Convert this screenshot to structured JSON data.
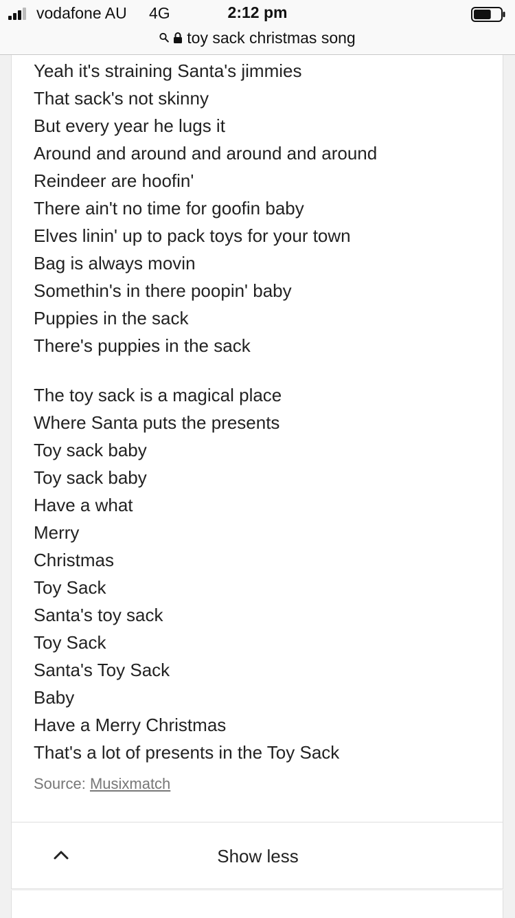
{
  "status_bar": {
    "carrier": "vodafone AU",
    "network": "4G",
    "time": "2:12 pm",
    "signal_bars": 3,
    "battery_level": 0.65
  },
  "url_bar": {
    "query": "toy sack christmas song",
    "search_icon": "search-icon",
    "lock_icon": "lock-icon"
  },
  "lyrics": {
    "stanza1": [
      "Yeah it's straining Santa's jimmies",
      "That sack's not skinny",
      "But every year he lugs it",
      "Around and around and around and around",
      "Reindeer are hoofin'",
      "There ain't no time for goofin baby",
      "Elves linin' up to pack toys for your town",
      "Bag is always movin",
      "Somethin's in there poopin' baby",
      "Puppies in the sack",
      "There's puppies in the sack"
    ],
    "stanza2": [
      "The toy sack is a magical place",
      "Where Santa puts the presents",
      "Toy sack baby",
      "Toy sack baby",
      "Have a what",
      "Merry",
      "Christmas",
      "Toy Sack",
      "Santa's toy sack",
      "Toy Sack",
      "Santa's Toy Sack",
      "Baby",
      "Have a Merry Christmas",
      "That's a lot of presents in the Toy Sack"
    ]
  },
  "source": {
    "label": "Source: ",
    "link_text": "Musixmatch"
  },
  "show_less": {
    "label": "Show less",
    "icon": "chevron-up-icon"
  }
}
